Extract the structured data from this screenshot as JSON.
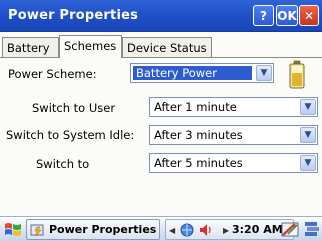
{
  "window": {
    "title": "Power Properties",
    "help_label": "?",
    "ok_label": "OK",
    "close_label": "✕"
  },
  "tabs": [
    {
      "label": "Battery",
      "active": false
    },
    {
      "label": "Schemes",
      "active": true
    },
    {
      "label": "Device Status",
      "active": false
    }
  ],
  "scheme": {
    "label": "Power Scheme:",
    "value": "Battery Power"
  },
  "settings": [
    {
      "label": "Switch to User",
      "value": "After 1 minute"
    },
    {
      "label": "Switch to System Idle:",
      "value": "After 3 minutes"
    },
    {
      "label": "Switch to",
      "value": "After 5 minutes"
    }
  ],
  "taskbar": {
    "task_label": "Power Properties",
    "clock": "3:20 AM"
  },
  "colors": {
    "titlebar": "#2f63d6",
    "selection": "#2d5ccf",
    "close": "#c4371d"
  },
  "icons": {
    "battery": "battery-icon",
    "start": "windows-flag-icon",
    "network": "network-icon",
    "speaker": "speaker-icon",
    "stylus": "stylus-icon",
    "desktop": "desktop-icon"
  }
}
